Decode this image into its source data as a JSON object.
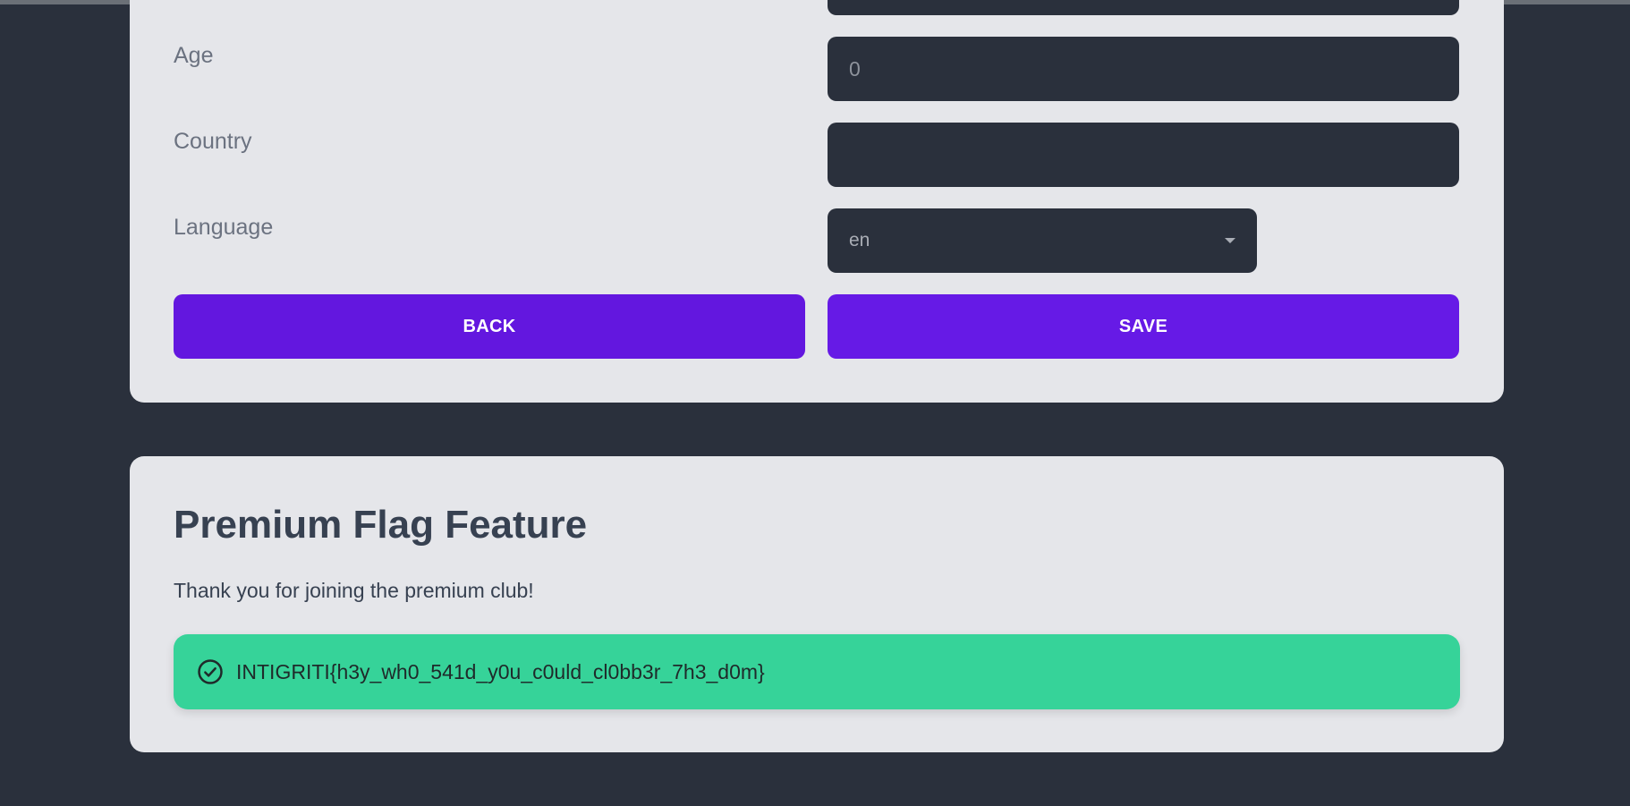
{
  "profile_form": {
    "age_label": "Age",
    "age_value": "0",
    "country_label": "Country",
    "country_value": "",
    "language_label": "Language",
    "language_selected": "en",
    "back_label": "BACK",
    "save_label": "SAVE"
  },
  "premium": {
    "title": "Premium Flag Feature",
    "message": "Thank you for joining the premium club!",
    "flag": "INTIGRITI{h3y_wh0_541d_y0u_c0uld_cl0bb3r_7h3_d0m}",
    "alert_icon": "check-circle-icon"
  },
  "colors": {
    "background": "#2a303c",
    "card": "#e5e6ea",
    "primary": "#661ae6",
    "success": "#36d399"
  }
}
